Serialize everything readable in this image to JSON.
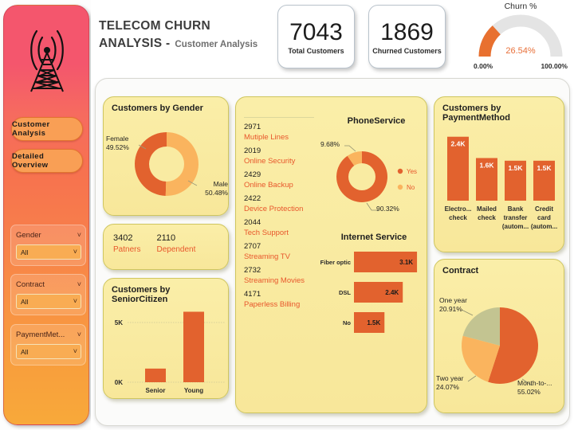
{
  "header": {
    "title_line1": "TELECOM CHURN",
    "title_line2": "ANALYSIS -",
    "title_sub": "Customer Analysis"
  },
  "kpis": [
    {
      "name": "total-customers",
      "value": "7043",
      "label": "Total Customers"
    },
    {
      "name": "churned-customers",
      "value": "1869",
      "label": "Churned Customers"
    }
  ],
  "gauge": {
    "title": "Churn %",
    "value_label": "26.54%",
    "value": 26.54,
    "min_label": "0.00%",
    "max_label": "100.00%",
    "fill_color": "#e8702f",
    "track_color": "#e3e3e3"
  },
  "sidebar": {
    "logo_icon": "cell-tower-icon",
    "nav": [
      {
        "name": "customer-analysis",
        "label": "Customer Analysis"
      },
      {
        "name": "detailed-overview",
        "label": "Detailed Overview"
      }
    ],
    "slicers": [
      {
        "name": "gender",
        "title": "Gender",
        "value": "All",
        "chevron": "chevron-down-icon"
      },
      {
        "name": "contract",
        "title": "Contract",
        "value": "All",
        "chevron": "chevron-down-icon"
      },
      {
        "name": "payment-method",
        "title": "PaymentMet...",
        "value": "All",
        "chevron": "chevron-down-icon"
      }
    ]
  },
  "panels": {
    "gender_title": "Customers by Gender",
    "senior_title": "Customers by SeniorCitizen",
    "payment_title": "Customers by PaymentMethod",
    "contract_title": "Contract",
    "phone_title": "PhoneService",
    "internet_title": "Internet Service"
  },
  "partners_card": {
    "partners_value": "3402",
    "partners_label": "Patners",
    "dependent_value": "2110",
    "dependent_label": "Dependent"
  },
  "metrics": [
    {
      "value": "2971",
      "label": "Mutiple Lines"
    },
    {
      "value": "2019",
      "label": "Online Security"
    },
    {
      "value": "2429",
      "label": "Online Backup"
    },
    {
      "value": "2422",
      "label": "Device Protection"
    },
    {
      "value": "2044",
      "label": "Tech Support"
    },
    {
      "value": "2707",
      "label": "Streaming TV"
    },
    {
      "value": "2732",
      "label": "Streaming Movies"
    },
    {
      "value": "4171",
      "label": "Paperless Billing"
    }
  ],
  "chart_data": [
    {
      "id": "customers-by-gender",
      "type": "pie",
      "title": "Customers by Gender",
      "labels": [
        "Female",
        "Male"
      ],
      "values": [
        49.52,
        50.48
      ],
      "value_labels": [
        "49.52%",
        "50.48%"
      ],
      "colors": [
        "#e2622e",
        "#fab45e"
      ],
      "donut": true,
      "legend": "none"
    },
    {
      "id": "customers-by-seniorcitizen",
      "type": "bar",
      "title": "Customers by SeniorCitizen",
      "categories": [
        "Senior",
        "Young"
      ],
      "values": [
        1142,
        5901
      ],
      "ylabel": "",
      "ytick_labels": [
        "0K",
        "5K"
      ],
      "ylim": [
        0,
        6400
      ],
      "bar_color": "#e2622e",
      "grid": true
    },
    {
      "id": "phoneservice",
      "type": "pie",
      "title": "PhoneService",
      "labels": [
        "Yes",
        "No"
      ],
      "values": [
        90.32,
        9.68
      ],
      "value_labels": [
        "90.32%",
        "9.68%"
      ],
      "colors": [
        "#e2622e",
        "#fab45e"
      ],
      "donut": true,
      "legend": "right"
    },
    {
      "id": "internet-service",
      "type": "bar",
      "orientation": "horizontal",
      "title": "Internet Service",
      "categories": [
        "Fiber optic",
        "DSL",
        "No"
      ],
      "values": [
        3.1,
        2.4,
        1.5
      ],
      "value_labels": [
        "3.1K",
        "2.4K",
        "1.5K"
      ],
      "xlim": [
        0,
        3.45
      ],
      "bar_color": "#e2622e",
      "grid": false
    },
    {
      "id": "customers-by-paymentmethod",
      "type": "bar",
      "title": "Customers by PaymentMethod",
      "categories": [
        "Electro...\ncheck",
        "Mailed\ncheck",
        "Bank\ntransfer\n(autom...",
        "Credit\ncard\n(autom..."
      ],
      "values": [
        2.4,
        1.6,
        1.5,
        1.5
      ],
      "value_labels": [
        "2.4K",
        "1.6K",
        "1.5K",
        "1.5K"
      ],
      "ylim": [
        0,
        2.75
      ],
      "bar_color": "#e2622e",
      "grid": false
    },
    {
      "id": "contract",
      "type": "pie",
      "title": "Contract",
      "labels": [
        "Month-to-...",
        "Two year",
        "One year"
      ],
      "values": [
        55.02,
        24.07,
        20.91
      ],
      "value_labels": [
        "55.02%",
        "24.07%",
        "20.91%"
      ],
      "colors": [
        "#e2622e",
        "#fab45e",
        "#c3c491"
      ],
      "donut": false,
      "legend": "none"
    }
  ]
}
